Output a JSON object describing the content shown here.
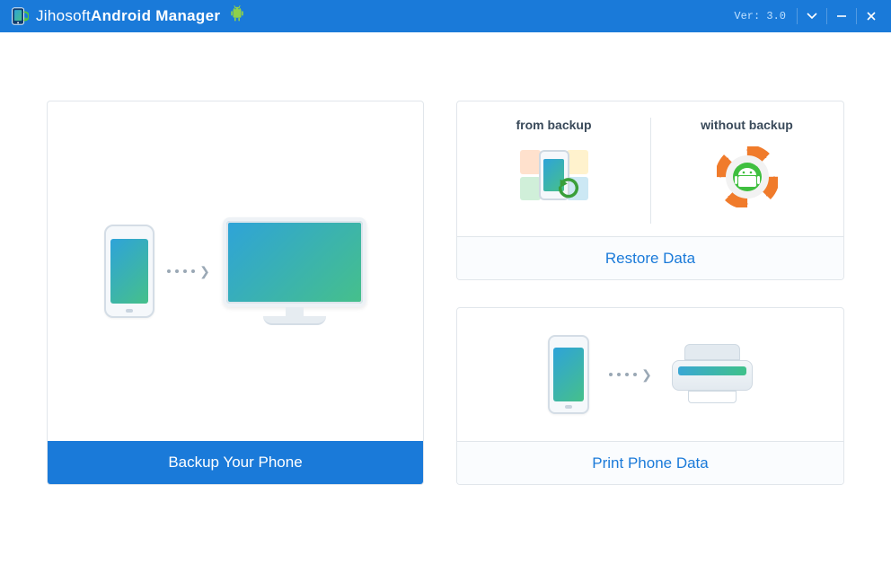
{
  "header": {
    "title_light": "Jihosoft ",
    "title_bold": "Android Manager",
    "version_label": "Ver: 3.0"
  },
  "cards": {
    "backup": {
      "footer": "Backup Your Phone"
    },
    "restore": {
      "from_backup_label": "from backup",
      "without_backup_label": "without backup",
      "footer": "Restore Data"
    },
    "print": {
      "footer": "Print Phone Data"
    }
  }
}
